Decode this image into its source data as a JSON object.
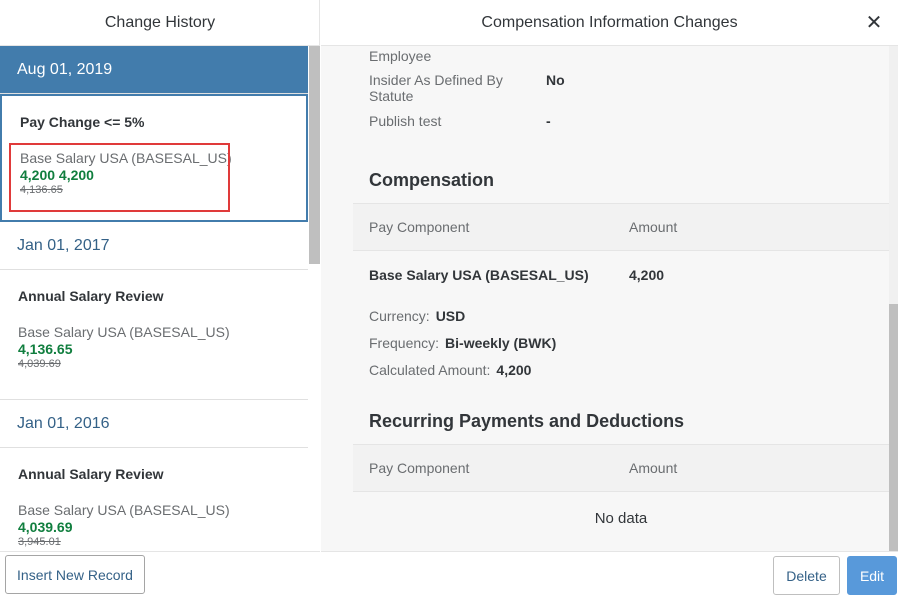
{
  "left_pane": {
    "title": "Change History",
    "entries": [
      {
        "date": "Aug 01, 2019",
        "event": "Pay Change <= 5%",
        "component": "Base Salary USA (BASESAL_US)",
        "new_value": "4,200 4,200",
        "old_value": "4,136.65",
        "selected": true
      },
      {
        "date": "Jan 01, 2017",
        "event": "Annual Salary Review",
        "component": "Base Salary USA (BASESAL_US)",
        "new_value": "4,136.65",
        "old_value": "4,039.69",
        "selected": false
      },
      {
        "date": "Jan 01, 2016",
        "event": "Annual Salary Review",
        "component": "Base Salary USA (BASESAL_US)",
        "new_value": "4,039.69",
        "old_value": "3,945.01",
        "selected": false
      }
    ],
    "insert_button": "Insert New Record"
  },
  "right_pane": {
    "title": "Compensation Information Changes",
    "close_glyph": "✕",
    "fields": [
      {
        "label": "Employee",
        "value": ""
      },
      {
        "label": "Insider As Defined By Statute",
        "value": "No"
      },
      {
        "label": "Publish test",
        "value": "-"
      }
    ],
    "compensation": {
      "title": "Compensation",
      "col_component": "Pay Component",
      "col_amount": "Amount",
      "row_component": "Base Salary USA (BASESAL_US)",
      "row_amount": "4,200",
      "currency_label": "Currency:",
      "currency_value": "USD",
      "frequency_label": "Frequency:",
      "frequency_value": "Bi-weekly (BWK)",
      "calc_label": "Calculated Amount:",
      "calc_value": "4,200"
    },
    "recurring": {
      "title": "Recurring Payments and Deductions",
      "col_component": "Pay Component",
      "col_amount": "Amount",
      "empty_text": "No data"
    },
    "delete_button": "Delete",
    "edit_button": "Edit"
  },
  "colors": {
    "selected_date_bg": "#427cac",
    "new_value": "#107e3e",
    "edit_button": "#5899da",
    "highlight_box": "#e03a3a"
  }
}
